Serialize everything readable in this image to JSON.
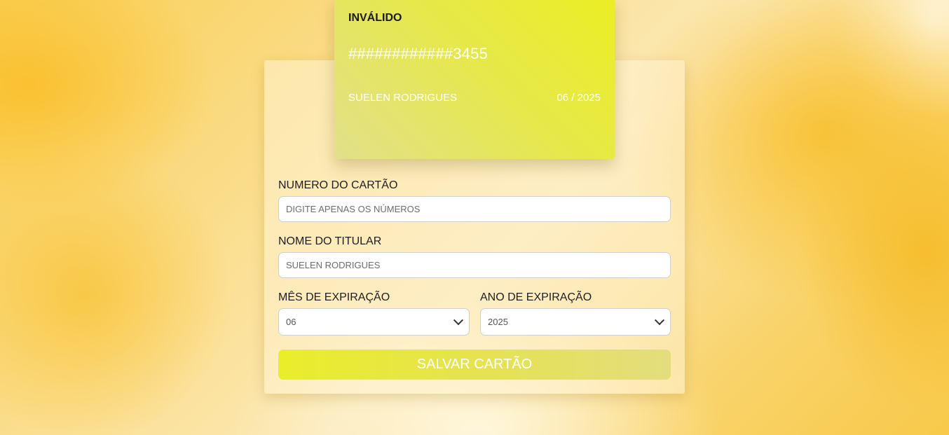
{
  "card": {
    "status": "INVÁLIDO",
    "number": "############3455",
    "holder": "SUELEN RODRIGUES",
    "expiry": "06 / 2025"
  },
  "form": {
    "card_number": {
      "label": "NUMERO DO CARTÃO",
      "placeholder": "DIGITE APENAS OS NÚMEROS",
      "value": ""
    },
    "holder_name": {
      "label": "NOME DO TITULAR",
      "placeholder": "SUELEN RODRIGUES",
      "value": ""
    },
    "expiry_month": {
      "label": "MÊS DE EXPIRAÇÃO",
      "selected": "06"
    },
    "expiry_year": {
      "label": "ANO DE EXPIRAÇÃO",
      "selected": "2025"
    },
    "save_label": "SALVAR CARTÃO"
  },
  "colors": {
    "card_accent": "#ebee24",
    "background": "#f9cf54"
  }
}
